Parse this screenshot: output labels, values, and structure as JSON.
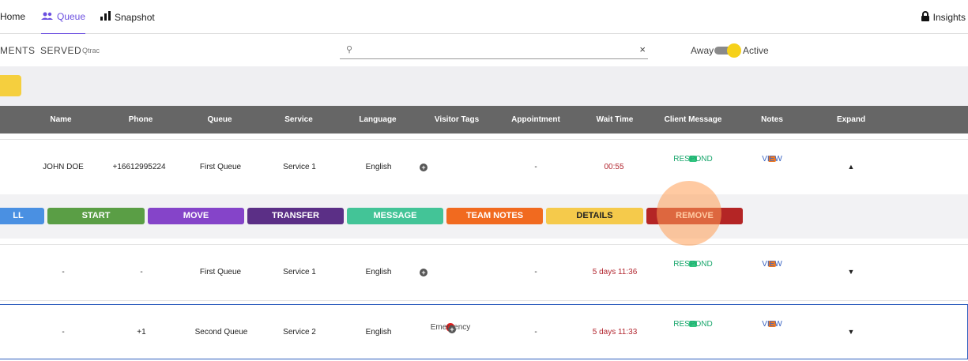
{
  "nav": {
    "home": "Home",
    "queue": "Queue",
    "snapshot": "Snapshot",
    "insights": "Insights"
  },
  "subnav": {
    "tabs": [
      "MENTS",
      "SERVED"
    ],
    "brand": "Qtrac"
  },
  "search": {
    "value": "",
    "placeholder": "",
    "clear": "×"
  },
  "status": {
    "away": "Away",
    "active": "Active"
  },
  "table": {
    "headers": [
      "Name",
      "Phone",
      "Queue",
      "Service",
      "Language",
      "Visitor Tags",
      "Appointment",
      "Wait Time",
      "Client Message",
      "Notes",
      "Expand"
    ],
    "rows": [
      {
        "name": "JOHN DOE",
        "phone": "+16612995224",
        "queue": "First Queue",
        "service": "Service 1",
        "language": "English",
        "tag": "",
        "appointment": "-",
        "wait": "00:55",
        "message": "RESPOND",
        "notes": "VIEW",
        "expand": "▲"
      },
      {
        "name": "-",
        "phone": "-",
        "queue": "First Queue",
        "service": "Service 1",
        "language": "English",
        "tag": "",
        "appointment": "-",
        "wait": "5 days 11:36",
        "message": "RESPOND",
        "notes": "VIEW",
        "expand": "▼"
      },
      {
        "name": "-",
        "phone": "+1",
        "queue": "Second Queue",
        "service": "Service 2",
        "language": "English",
        "tag": "Emergency",
        "appointment": "-",
        "wait": "5 days 11:33",
        "message": "RESPOND",
        "notes": "VIEW",
        "expand": "▼"
      }
    ]
  },
  "actions": [
    "LL",
    "START",
    "MOVE",
    "TRANSFER",
    "MESSAGE",
    "TEAM NOTES",
    "DETAILS",
    "REMOVE"
  ],
  "colors": {
    "accent": "#6b4fe0",
    "start": "#5a9e45",
    "move": "#8544c9",
    "transfer": "#5b2f86",
    "message": "#43c497",
    "team_notes": "#f16a1f",
    "details": "#f5ca4b",
    "remove": "#b42525",
    "call": "#4a90e2"
  }
}
